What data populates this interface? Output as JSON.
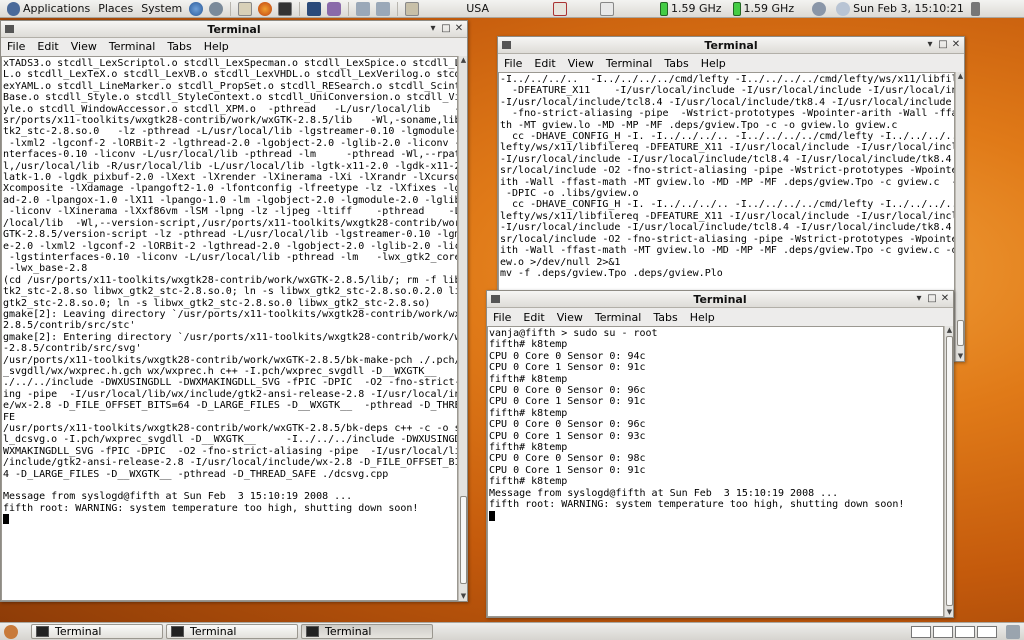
{
  "top_panel": {
    "menus": [
      "Applications",
      "Places",
      "System"
    ],
    "keyboard_layout": "USA",
    "cpu1_freq": "1.59 GHz",
    "cpu2_freq": "1.59 GHz",
    "clock": "Sun Feb  3, 15:10:21"
  },
  "taskbar": {
    "tasks": [
      "Terminal",
      "Terminal",
      "Terminal"
    ]
  },
  "menu_labels": [
    "File",
    "Edit",
    "View",
    "Terminal",
    "Tabs",
    "Help"
  ],
  "window_left": {
    "title": "Terminal",
    "lines": [
      "xTADS3.o stcdll_LexScriptol.o stcdll_LexSpecman.o stcdll_LexSpice.o stcdll_LexTC",
      "L.o stcdll_LexTeX.o stcdll_LexVB.o stcdll_LexVHDL.o stcdll_LexVerilog.o stcdll_L",
      "exYAML.o stcdll_LineMarker.o stcdll_PropSet.o stcdll_RESearch.o stcdll_Scintilla",
      "Base.o stcdll_Style.o stcdll_StyleContext.o stcdll_UniConversion.o stcdll_ViewSt",
      "yle.o stcdll_WindowAccessor.o stcdll_XPM.o  -pthread   -L/usr/local/lib    -L/u",
      "sr/ports/x11-toolkits/wxgtk28-contrib/work/wxGTK-2.8.5/lib   -Wl,-soname,libwx_g",
      "tk2_stc-2.8.so.0   -lz -pthread -L/usr/local/lib -lgstreamer-0.10 -lgmodule-2.0",
      " -lxml2 -lgconf-2 -lORBit-2 -lgthread-2.0 -lgobject-2.0 -lglib-2.0 -liconv -lgsti",
      "nterfaces-0.10 -liconv -L/usr/local/lib -pthread -lm     -pthread -Wl,--rpath -W",
      "l,/usr/local/lib -R/usr/local/lib -L/usr/local/lib -lgtk-x11-2.0 -lgdk-x11-2.0 -",
      "latk-1.0 -lgdk_pixbuf-2.0 -lXext -lXrender -lXinerama -lXi -lXrandr -lXcursor -l",
      "Xcomposite -lXdamage -lpangoft2-1.0 -lfontconfig -lfreetype -lz -lXfixes -lgthre",
      "ad-2.0 -lpangox-1.0 -lX11 -lpango-1.0 -lm -lgobject-2.0 -lgmodule-2.0 -lglib-2.0",
      " -liconv -lXinerama -lXxf86vm -lSM -lpng -lz -ljpeg -ltiff    -pthread    -L/usr",
      "/local/lib  -Wl,--version-script,/usr/ports/x11-toolkits/wxgtk28-contrib/work/wx",
      "GTK-2.8.5/version-script -lz -pthread -L/usr/local/lib -lgstreamer-0.10 -lgmodule",
      "e-2.0 -lxml2 -lgconf-2 -lORBit-2 -lgthread-2.0 -lgobject-2.0 -lglib-2.0 -liconv",
      " -lgstinterfaces-0.10 -liconv -L/usr/local/lib -pthread -lm   -lwx_gtk2_core-2.8",
      " -lwx_base-2.8",
      "(cd /usr/ports/x11-toolkits/wxgtk28-contrib/work/wxGTK-2.8.5/lib/; rm -f libwx_g",
      "tk2_stc-2.8.so libwx_gtk2_stc-2.8.so.0; ln -s libwx_gtk2_stc-2.8.so.0.2.0 libwx_",
      "gtk2_stc-2.8.so.0; ln -s libwx_gtk2_stc-2.8.so.0 libwx_gtk2_stc-2.8.so)",
      "gmake[2]: Leaving directory `/usr/ports/x11-toolkits/wxgtk28-contrib/work/wxGTK-",
      "2.8.5/contrib/src/stc'",
      "gmake[2]: Entering directory `/usr/ports/x11-toolkits/wxgtk28-contrib/work/wxGTK",
      "-2.8.5/contrib/src/svg'",
      "/usr/ports/x11-toolkits/wxgtk28-contrib/work/wxGTK-2.8.5/bk-make-pch ./.pch/wxprec",
      "_svgdll/wx/wxprec.h.gch wx/wxprec.h c++ -I.pch/wxprec_svgdll -D__WXGTK__     -I.",
      "./../../include -DWXUSINGDLL -DWXMAKINGDLL_SVG -fPIC -DPIC  -O2 -fno-strict-alias",
      "ing -pipe  -I/usr/local/lib/wx/include/gtk2-ansi-release-2.8 -I/usr/local/include",
      "e/wx-2.8 -D_FILE_OFFSET_BITS=64 -D_LARGE_FILES -D__WXGTK__  -pthread -D_THREAD_SA",
      "FE",
      "/usr/ports/x11-toolkits/wxgtk28-contrib/work/wxGTK-2.8.5/bk-deps c++ -c -o svgdl",
      "l_dcsvg.o -I.pch/wxprec_svgdll -D__WXGTK__     -I../../../include -DWXUSINGDLL -D",
      "WXMAKINGDLL_SVG -fPIC -DPIC  -O2 -fno-strict-aliasing -pipe  -I/usr/local/lib/wx",
      "/include/gtk2-ansi-release-2.8 -I/usr/local/include/wx-2.8 -D_FILE_OFFSET_BITS=6",
      "4 -D_LARGE_FILES -D__WXGTK__ -pthread -D_THREAD_SAFE ./dcsvg.cpp",
      "",
      "Message from syslogd@fifth at Sun Feb  3 15:10:19 2008 ...",
      "fifth root: WARNING: system temperature too high, shutting down soon!"
    ]
  },
  "window_right_top": {
    "title": "Terminal",
    "lines": [
      "-I../../../..  -I../../../../cmd/lefty -I../../../../cmd/lefty/ws/x11/libfilereq",
      "  -DFEATURE_X11    -I/usr/local/include -I/usr/local/include -I/usr/local/include",
      "-I/usr/local/include/tcl8.4 -I/usr/local/include/tk8.4 -I/usr/local/include  -O2",
      "  -fno-strict-aliasing -pipe  -Wstrict-prototypes -Wpointer-arith -Wall -ffast-ma",
      "th -MT gview.lo -MD -MP -MF .deps/gview.Tpo -c -o gview.lo gview.c",
      "  cc -DHAVE_CONFIG_H -I. -I../../../.. -I../../../../cmd/lefty -I../../../../cmd/",
      "lefty/ws/x11/libfilereq -DFEATURE_X11 -I/usr/local/include -I/usr/local/include",
      "-I/usr/local/include -I/usr/local/include/tcl8.4 -I/usr/local/include/tk8.4 -I/u",
      "sr/local/include -O2 -fno-strict-aliasing -pipe -Wstrict-prototypes -Wpointer-ar",
      "ith -Wall -ffast-math -MT gview.lo -MD -MP -MF .deps/gview.Tpo -c gview.c  -fPIC",
      " -DPIC -o .libs/gview.o",
      "  cc -DHAVE_CONFIG_H -I. -I../../../.. -I../../../../cmd/lefty -I../../../../cmd/",
      "lefty/ws/x11/libfilereq -DFEATURE_X11 -I/usr/local/include -I/usr/local/include",
      "-I/usr/local/include -I/usr/local/include/tcl8.4 -I/usr/local/include/tk8.4 -I/u",
      "sr/local/include -O2 -fno-strict-aliasing -pipe -Wstrict-prototypes -Wpointer-ar",
      "ith -Wall -ffast-math -MT gview.lo -MD -MP -MF .deps/gview.Tpo -c gview.c -o gvi",
      "ew.o >/dev/null 2>&1",
      "mv -f .deps/gview.Tpo .deps/gview.Plo"
    ]
  },
  "window_right_bottom": {
    "title": "Terminal",
    "lines": [
      "vanja@fifth > sudo su - root",
      "fifth# k8temp",
      "CPU 0 Core 0 Sensor 0: 94c",
      "CPU 0 Core 1 Sensor 0: 91c",
      "fifth# k8temp",
      "CPU 0 Core 0 Sensor 0: 96c",
      "CPU 0 Core 1 Sensor 0: 91c",
      "fifth# k8temp",
      "CPU 0 Core 0 Sensor 0: 96c",
      "CPU 0 Core 1 Sensor 0: 93c",
      "fifth# k8temp",
      "CPU 0 Core 0 Sensor 0: 98c",
      "CPU 0 Core 1 Sensor 0: 91c",
      "fifth# k8temp",
      "Message from syslogd@fifth at Sun Feb  3 15:10:19 2008 ...",
      "fifth root: WARNING: system temperature too high, shutting down soon!"
    ]
  }
}
